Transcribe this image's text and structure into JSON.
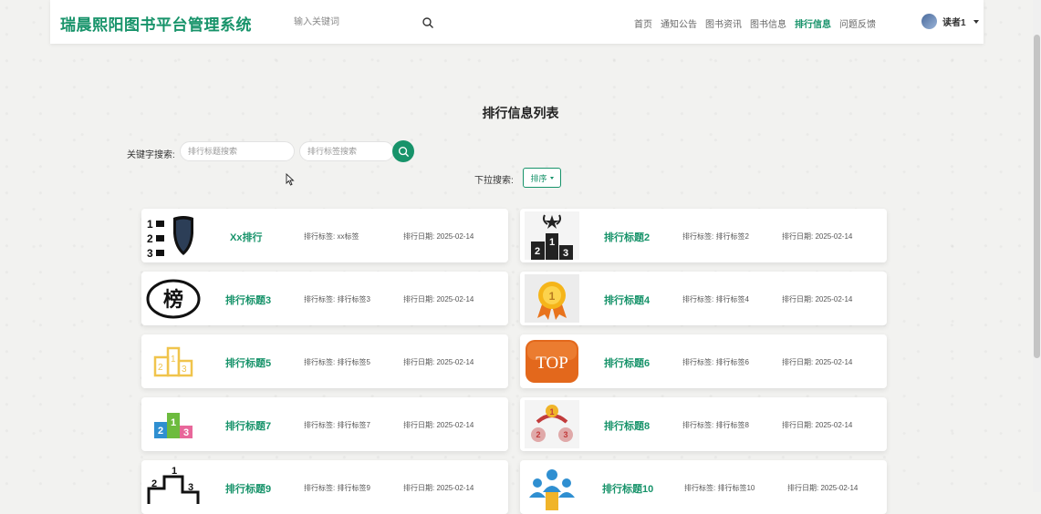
{
  "header": {
    "logo": "瑞晨熙阳图书平台管理系统",
    "search_placeholder": "输入关键词",
    "nav": [
      "首页",
      "通知公告",
      "图书资讯",
      "图书信息",
      "排行信息",
      "问题反馈"
    ],
    "nav_active": "排行信息",
    "user": "读者1"
  },
  "page": {
    "title": "排行信息列表",
    "keyword_label": "关键字搜索:",
    "title_placeholder": "排行标题搜索",
    "tag_placeholder": "排行标签搜索",
    "dropdown_label": "下拉搜索:",
    "sort_label": "排序"
  },
  "colors": {
    "accent": "#17936a"
  },
  "cards": [
    {
      "title": "Xx排行",
      "tag": "排行标签: xx标签",
      "date": "排行日期: 2025-02-14",
      "icon": "shield-rank-icon"
    },
    {
      "title": "排行标题2",
      "tag": "排行标签: 排行标签2",
      "date": "排行日期: 2025-02-14",
      "icon": "podium-star-icon"
    },
    {
      "title": "排行标题3",
      "tag": "排行标签: 排行标签3",
      "date": "排行日期: 2025-02-14",
      "icon": "bang-badge-icon",
      "icon_text": "榜"
    },
    {
      "title": "排行标题4",
      "tag": "排行标签: 排行标签4",
      "date": "排行日期: 2025-02-14",
      "icon": "gold-medal-icon",
      "icon_text": "1"
    },
    {
      "title": "排行标题5",
      "tag": "排行标签: 排行标签5",
      "date": "排行日期: 2025-02-14",
      "icon": "yellow-podium-icon"
    },
    {
      "title": "排行标题6",
      "tag": "排行标签: 排行标签6",
      "date": "排行日期: 2025-02-14",
      "icon": "top-button-icon",
      "icon_text": "TOP"
    },
    {
      "title": "排行标题7",
      "tag": "排行标签: 排行标签7",
      "date": "排行日期: 2025-02-14",
      "icon": "color-podium-icon"
    },
    {
      "title": "排行标题8",
      "tag": "排行标签: 排行标签8",
      "date": "排行日期: 2025-02-14",
      "icon": "medals-icon"
    },
    {
      "title": "排行标题9",
      "tag": "排行标签: 排行标签9",
      "date": "排行日期: 2025-02-14",
      "icon": "outline-podium-icon"
    },
    {
      "title": "排行标题10",
      "tag": "排行标签: 排行标签10",
      "date": "排行日期: 2025-02-14",
      "icon": "people-rank-icon"
    }
  ]
}
